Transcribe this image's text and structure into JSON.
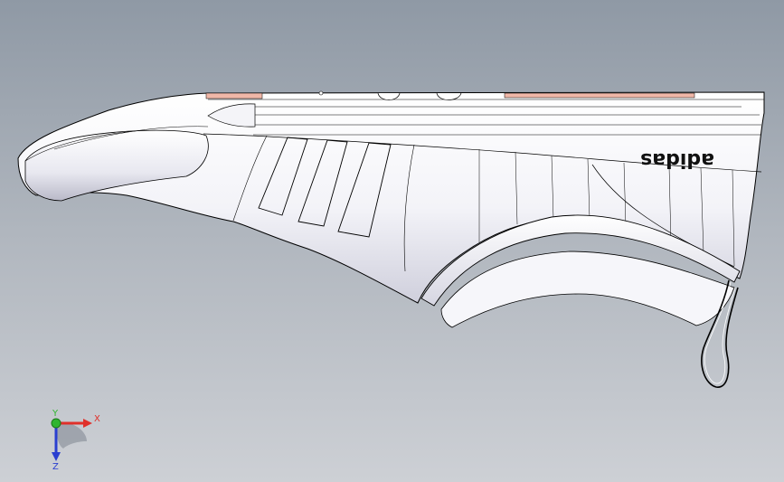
{
  "scene": {
    "brand_text": "adidas",
    "background_top": "#8f99a5",
    "background_bottom": "#cdd0d5",
    "model_color": "#ffffff",
    "shade_color": "#d9d9e6",
    "highlight_strip_color": "#f0b7a8"
  },
  "triad": {
    "x_label": "X",
    "y_label": "Y",
    "z_label": "Z",
    "x_color": "#e0302a",
    "y_color": "#2fb52f",
    "z_color": "#2a3fd0"
  }
}
